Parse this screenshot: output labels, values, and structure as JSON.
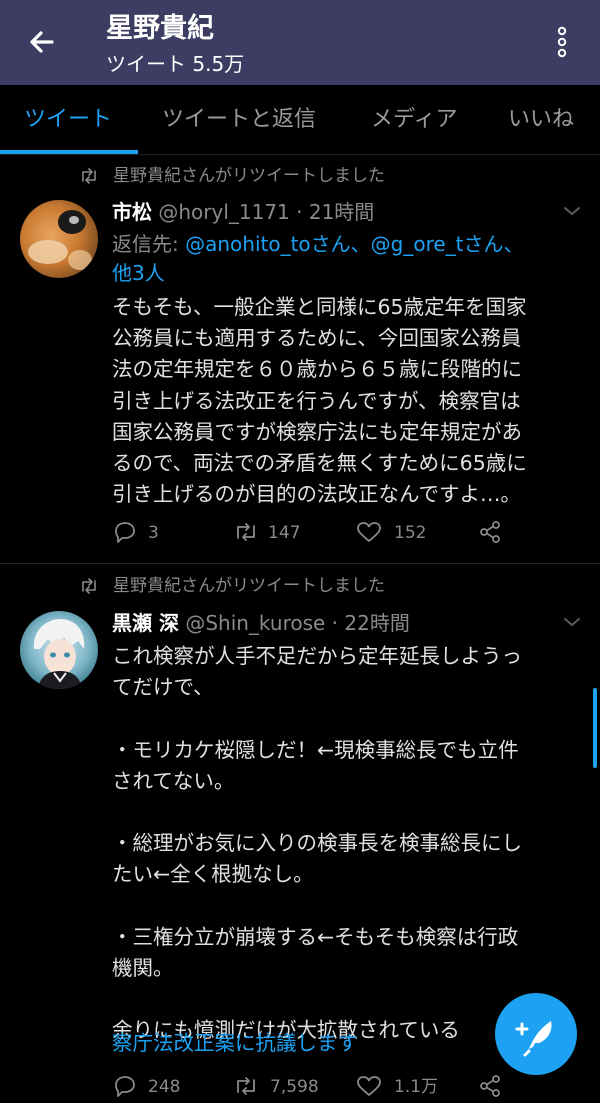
{
  "header": {
    "title": "星野貴紀",
    "subtitle": "ツイート 5.5万"
  },
  "tabs": [
    {
      "label": "ツイート",
      "active": true
    },
    {
      "label": "ツイートと返信",
      "active": false
    },
    {
      "label": "メディア",
      "active": false
    },
    {
      "label": "いいね",
      "active": false
    }
  ],
  "tweets": [
    {
      "retweet_label": "星野貴紀さんがリツイートしました",
      "name": "市松",
      "handle": "@horyl_1171 · 21時間",
      "reply_prefix": "返信先: ",
      "reply_users": "@anohito_toさん、@g_ore_tさん、",
      "reply_others": "他3人",
      "body": "そもそも、一般企業と同様に65歳定年を国家\n公務員にも適用するために、今回国家公務員\n法の定年規定を６０歳から６５歳に段階的に\n引き上げる法改正を行うんですが、検察官は\n国家公務員ですが検察庁法にも定年規定があ\nるので、両法での矛盾を無くすために65歳に\n引き上げるのが目的の法改正なんですよ…。",
      "replies": "3",
      "retweets": "147",
      "likes": "152"
    },
    {
      "retweet_label": "星野貴紀さんがリツイートしました",
      "name": "黒瀬 深",
      "handle": "@Shin_kurose · 22時間",
      "body": "これ検察が人手不足だから定年延長しようっ\nてだけで、\n\n・モリカケ桜隠しだ！←現検事総長でも立件\nされてない。\n\n・総理がお気に入りの検事長を検事総長にし\nたい←全く根拠なし。\n\n・三権分立が崩壊する←そもそも検察は行政\n機関。\n\n余りにも憶測だけが大拡散されている",
      "hashtag": "察庁法改正案に抗議します",
      "replies": "248",
      "retweets": "7,598",
      "likes": "1.1万"
    }
  ],
  "colors": {
    "header_bg": "#3d3c62",
    "accent": "#1da1f2",
    "background": "#000000"
  }
}
